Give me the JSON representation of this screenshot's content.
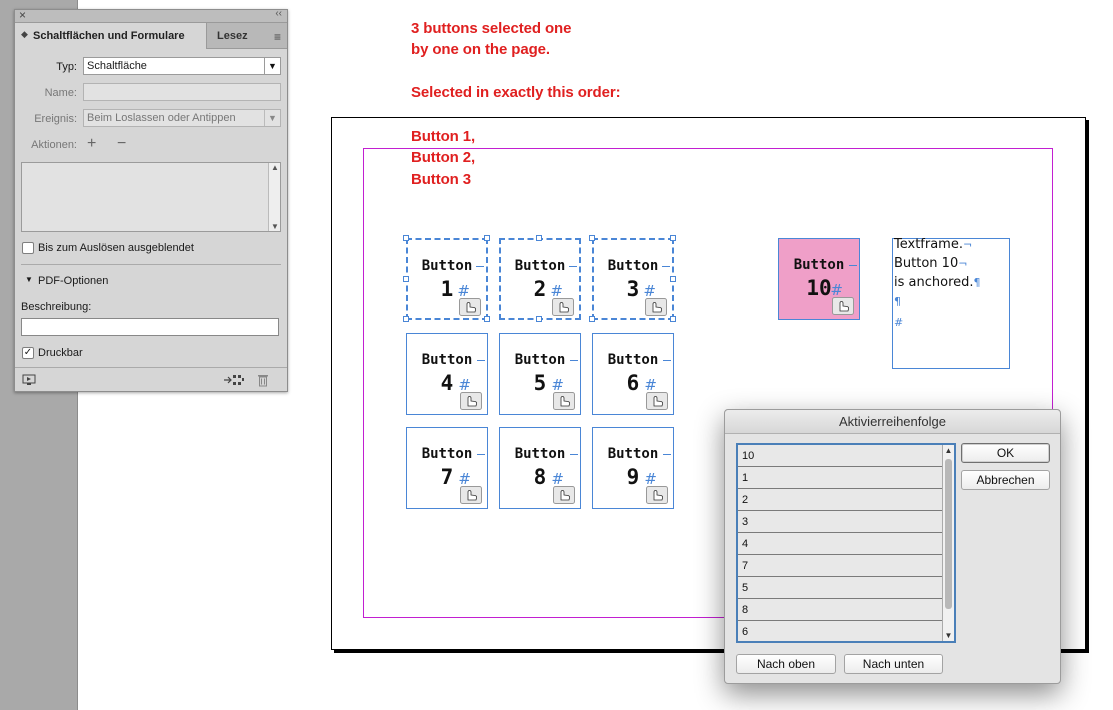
{
  "panel": {
    "close_icon": "×",
    "collapse_icon": "‹‹",
    "tab_active": "Schaltflächen und Formulare",
    "tab_other": "Lesez",
    "menu_icon": "≡",
    "typ_label": "Typ:",
    "typ_value": "Schaltfläche",
    "name_label": "Name:",
    "name_value": "",
    "ereignis_label": "Ereignis:",
    "ereignis_value": "Beim Loslassen oder Antippen",
    "aktionen_label": "Aktionen:",
    "add_icon": "+",
    "remove_icon": "−",
    "hidden_until_triggered_label": "Bis zum Auslösen ausgeblendet",
    "hidden_until_triggered_checked": false,
    "pdf_options_label": "PDF-Optionen",
    "beschreibung_label": "Beschreibung:",
    "beschreibung_value": "",
    "druckbar_label": "Druckbar",
    "druckbar_checked": true
  },
  "annotations": {
    "line1": "3 buttons selected one",
    "line2": "by one on the page.",
    "line3": "Selected in exactly this order:",
    "line4": "Button 1,",
    "line5": "Button 2,",
    "line6": "Button 3"
  },
  "buttons": [
    {
      "line1": "Button",
      "line2": "1",
      "selected": true
    },
    {
      "line1": "Button",
      "line2": "2",
      "selected": true
    },
    {
      "line1": "Button",
      "line2": "3",
      "selected": true
    },
    {
      "line1": "Button",
      "line2": "4",
      "selected": false
    },
    {
      "line1": "Button",
      "line2": "5",
      "selected": false
    },
    {
      "line1": "Button",
      "line2": "6",
      "selected": false
    },
    {
      "line1": "Button",
      "line2": "7",
      "selected": false
    },
    {
      "line1": "Button",
      "line2": "8",
      "selected": false
    },
    {
      "line1": "Button",
      "line2": "9",
      "selected": false
    }
  ],
  "button10": {
    "line1": "Button",
    "line2": "10",
    "color": "#ef9fc8"
  },
  "textframe": {
    "line1": "Textframe.",
    "line2": "Button 10",
    "line3": "is anchored.",
    "hash": "#",
    "pilcrow": "¶",
    "eol": "¬",
    "anchor": "⌘"
  },
  "dialog": {
    "title": "Aktivierreihenfolge",
    "items": [
      "10",
      "1",
      "2",
      "3",
      "4",
      "7",
      "5",
      "8",
      "6"
    ],
    "ok_label": "OK",
    "cancel_label": "Abbrechen",
    "move_up_label": "Nach oben",
    "move_down_label": "Nach unten"
  },
  "colors": {
    "annotation": "#e02020",
    "frame_blue": "#4a86d6",
    "margin_guide": "#c21fd1"
  }
}
